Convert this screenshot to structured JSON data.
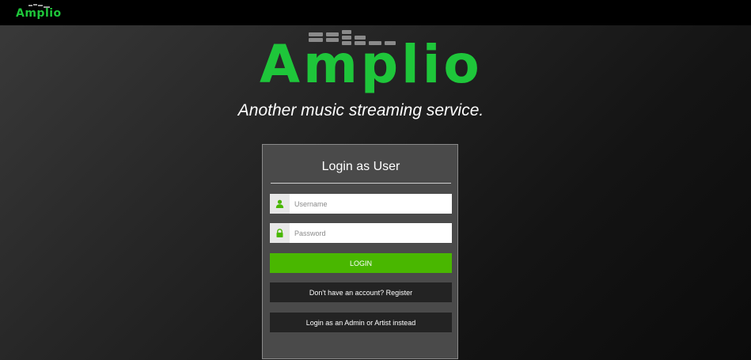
{
  "topbar": {
    "brand": "Amplio"
  },
  "hero": {
    "logo": "Amplio",
    "tagline": "Another music streaming service."
  },
  "login": {
    "title": "Login as User",
    "username_placeholder": "Username",
    "password_placeholder": "Password",
    "login_label": "LOGIN",
    "register_label": "Don't have an account? Register",
    "alt_login_label": "Login as an Admin or Artist instead"
  },
  "icons": {
    "username": "user-icon",
    "password": "lock-icon"
  },
  "colors": {
    "brand_green": "#1ec63a",
    "button_green": "#49b700",
    "panel_bg": "#4a4a4a",
    "dark_button": "#232323"
  }
}
